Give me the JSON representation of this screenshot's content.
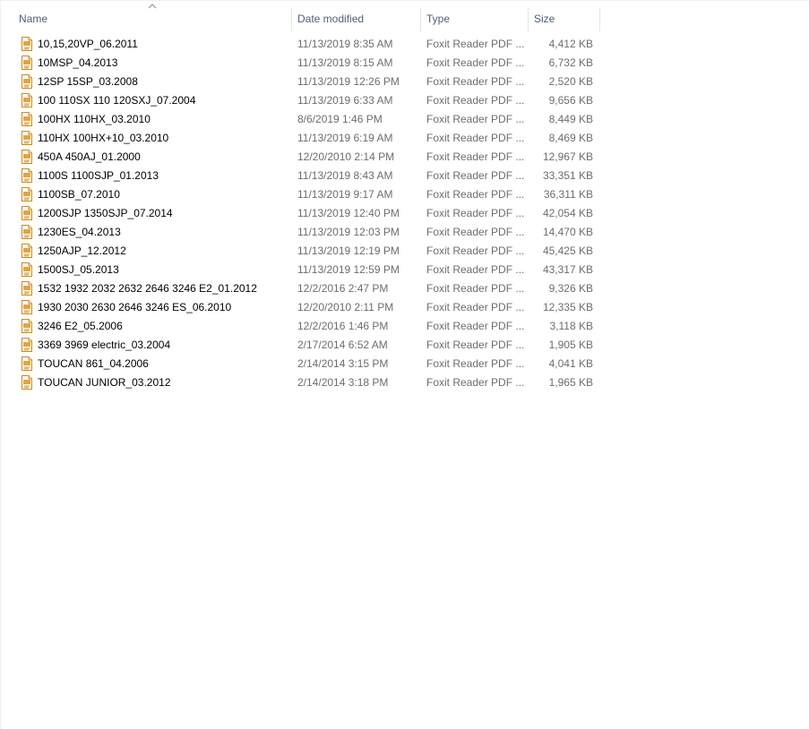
{
  "columns": {
    "name": "Name",
    "date": "Date modified",
    "type": "Type",
    "size": "Size"
  },
  "sort_indicator_icon": "chevron-up-icon",
  "file_icon": "pdf-file-icon",
  "files": [
    {
      "name": "10,15,20VP_06.2011",
      "date": "11/13/2019 8:35 AM",
      "type": "Foxit Reader PDF ...",
      "size": "4,412 KB"
    },
    {
      "name": "10MSP_04.2013",
      "date": "11/13/2019 8:15 AM",
      "type": "Foxit Reader PDF ...",
      "size": "6,732 KB"
    },
    {
      "name": "12SP 15SP_03.2008",
      "date": "11/13/2019 12:26 PM",
      "type": "Foxit Reader PDF ...",
      "size": "2,520 KB"
    },
    {
      "name": "100 110SX 110 120SXJ_07.2004",
      "date": "11/13/2019 6:33 AM",
      "type": "Foxit Reader PDF ...",
      "size": "9,656 KB"
    },
    {
      "name": "100HX 110HX_03.2010",
      "date": "8/6/2019 1:46 PM",
      "type": "Foxit Reader PDF ...",
      "size": "8,449 KB"
    },
    {
      "name": "110HX 100HX+10_03.2010",
      "date": "11/13/2019 6:19 AM",
      "type": "Foxit Reader PDF ...",
      "size": "8,469 KB"
    },
    {
      "name": "450A 450AJ_01.2000",
      "date": "12/20/2010 2:14 PM",
      "type": "Foxit Reader PDF ...",
      "size": "12,967 KB"
    },
    {
      "name": "1100S 1100SJP_01.2013",
      "date": "11/13/2019 8:43 AM",
      "type": "Foxit Reader PDF ...",
      "size": "33,351 KB"
    },
    {
      "name": "1100SB_07.2010",
      "date": "11/13/2019 9:17 AM",
      "type": "Foxit Reader PDF ...",
      "size": "36,311 KB"
    },
    {
      "name": "1200SJP 1350SJP_07.2014",
      "date": "11/13/2019 12:40 PM",
      "type": "Foxit Reader PDF ...",
      "size": "42,054 KB"
    },
    {
      "name": "1230ES_04.2013",
      "date": "11/13/2019 12:03 PM",
      "type": "Foxit Reader PDF ...",
      "size": "14,470 KB"
    },
    {
      "name": "1250AJP_12.2012",
      "date": "11/13/2019 12:19 PM",
      "type": "Foxit Reader PDF ...",
      "size": "45,425 KB"
    },
    {
      "name": "1500SJ_05.2013",
      "date": "11/13/2019 12:59 PM",
      "type": "Foxit Reader PDF ...",
      "size": "43,317 KB"
    },
    {
      "name": "1532 1932 2032 2632 2646 3246 E2_01.2012",
      "date": "12/2/2016 2:47 PM",
      "type": "Foxit Reader PDF ...",
      "size": "9,326 KB"
    },
    {
      "name": "1930 2030 2630 2646 3246 ES_06.2010",
      "date": "12/20/2010 2:11 PM",
      "type": "Foxit Reader PDF ...",
      "size": "12,335 KB"
    },
    {
      "name": "3246 E2_05.2006",
      "date": "12/2/2016 1:46 PM",
      "type": "Foxit Reader PDF ...",
      "size": "3,118 KB"
    },
    {
      "name": "3369 3969 electric_03.2004",
      "date": "2/17/2014 6:52 AM",
      "type": "Foxit Reader PDF ...",
      "size": "1,905 KB"
    },
    {
      "name": "TOUCAN 861_04.2006",
      "date": "2/14/2014 3:15 PM",
      "type": "Foxit Reader PDF ...",
      "size": "4,041 KB"
    },
    {
      "name": "TOUCAN JUNIOR_03.2012",
      "date": "2/14/2014 3:18 PM",
      "type": "Foxit Reader PDF ...",
      "size": "1,965 KB"
    }
  ]
}
